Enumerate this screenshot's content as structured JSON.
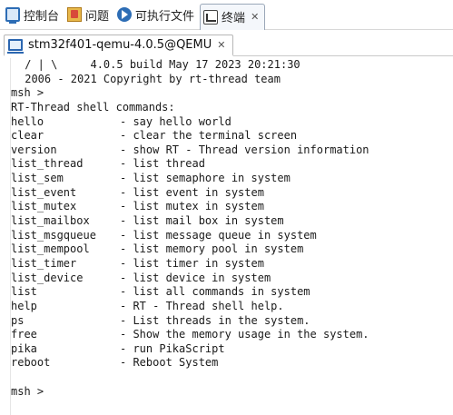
{
  "view_tabs": [
    {
      "label": "控制台",
      "icon": "console-icon"
    },
    {
      "label": "问题",
      "icon": "problems-icon"
    },
    {
      "label": "可执行文件",
      "icon": "executables-icon"
    },
    {
      "label": "终端",
      "icon": "terminal-icon",
      "active": true,
      "close": "✕"
    }
  ],
  "session": {
    "label": "stm32f401-qemu-4.0.5@QEMU",
    "close": "✕",
    "icon": "monitor-icon"
  },
  "terminal": {
    "banner": [
      " / | \\     4.0.5 build May 17 2023 20:21:30",
      " 2006 - 2021 Copyright by rt-thread team"
    ],
    "prompt": "msh >",
    "header": "RT-Thread shell commands:",
    "commands": [
      {
        "name": "hello",
        "desc": "- say hello world"
      },
      {
        "name": "clear",
        "desc": "- clear the terminal screen"
      },
      {
        "name": "version",
        "desc": "- show RT - Thread version information"
      },
      {
        "name": "list_thread",
        "desc": "- list thread"
      },
      {
        "name": "list_sem",
        "desc": "- list semaphore in system"
      },
      {
        "name": "list_event",
        "desc": "- list event in system"
      },
      {
        "name": "list_mutex",
        "desc": "- list mutex in system"
      },
      {
        "name": "list_mailbox",
        "desc": "- list mail box in system"
      },
      {
        "name": "list_msgqueue",
        "desc": "- list message queue in system"
      },
      {
        "name": "list_mempool",
        "desc": "- list memory pool in system"
      },
      {
        "name": "list_timer",
        "desc": "- list timer in system"
      },
      {
        "name": "list_device",
        "desc": "- list device in system"
      },
      {
        "name": "list",
        "desc": "- list all commands in system"
      },
      {
        "name": "help",
        "desc": "- RT - Thread shell help."
      },
      {
        "name": "ps",
        "desc": "- List threads in the system."
      },
      {
        "name": "free",
        "desc": "- Show the memory usage in the system."
      },
      {
        "name": "pika",
        "desc": "- run PikaScript"
      },
      {
        "name": "reboot",
        "desc": "- Reboot System"
      }
    ],
    "final_prompt": "msh >"
  },
  "colors": {
    "accent": "#2d6db5",
    "text": "#1a1a1a"
  }
}
